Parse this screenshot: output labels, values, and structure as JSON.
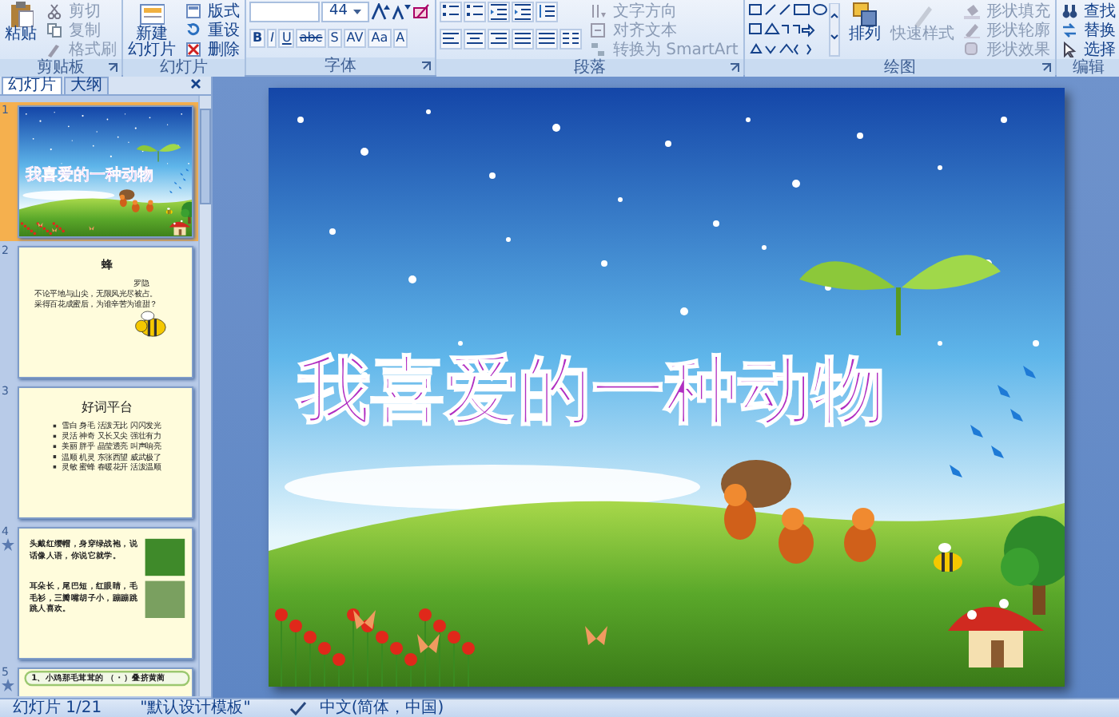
{
  "ribbon": {
    "groups": [
      {
        "kind": "clipboard",
        "label": "剪贴板",
        "launcher": true,
        "large": [
          {
            "lines": [
              "粘贴"
            ],
            "disabled": false
          }
        ],
        "small": [
          {
            "label": "剪切",
            "disabled": true
          },
          {
            "label": "复制",
            "disabled": true
          },
          {
            "label": "格式刷",
            "disabled": true
          }
        ]
      },
      {
        "kind": "slides",
        "label": "幻灯片",
        "launcher": false,
        "large": [
          {
            "lines": [
              "新建",
              "幻灯片"
            ],
            "disabled": false
          }
        ],
        "small": [
          {
            "label": "版式",
            "disabled": false
          },
          {
            "label": "重设",
            "disabled": false
          },
          {
            "label": "删除",
            "disabled": false
          }
        ]
      },
      {
        "kind": "font",
        "label": "字体",
        "launcher": true,
        "font_size": "44",
        "format_buttons": [
          "B",
          "I",
          "U",
          "abc",
          "S",
          "AV",
          "Aa",
          "A"
        ]
      },
      {
        "kind": "paragraph",
        "label": "段落",
        "launcher": true,
        "small": [
          {
            "label": "文字方向",
            "disabled": true
          },
          {
            "label": "对齐文本",
            "disabled": true
          },
          {
            "label": "转换为 SmartArt",
            "disabled": true
          }
        ]
      },
      {
        "kind": "drawing",
        "label": "绘图",
        "launcher": true,
        "large": [
          {
            "lines": [
              "排列"
            ],
            "disabled": false
          },
          {
            "lines": [
              "快速样式"
            ],
            "disabled": true
          }
        ],
        "small": [
          {
            "label": "形状填充",
            "disabled": true
          },
          {
            "label": "形状轮廓",
            "disabled": true
          },
          {
            "label": "形状效果",
            "disabled": true
          }
        ]
      },
      {
        "kind": "editing",
        "label": "编辑",
        "launcher": false,
        "small": [
          {
            "label": "查找",
            "disabled": false
          },
          {
            "label": "替换",
            "disabled": false
          },
          {
            "label": "选择",
            "disabled": false
          }
        ]
      }
    ]
  },
  "panel_tabs": [
    {
      "label": "幻灯片",
      "selected": true
    },
    {
      "label": "大纲",
      "selected": false
    }
  ],
  "thumbnails": [
    {
      "number": "1",
      "selected": true,
      "has_animation": false,
      "kind": "title",
      "title": "我喜爱的一种动物"
    },
    {
      "number": "2",
      "selected": false,
      "has_animation": false,
      "kind": "poem",
      "title": "蜂",
      "author": "罗隐",
      "lines": [
        "不论平地与山尖，无限风光尽被占。",
        "采得百花成蜜后，为谁辛苦为谁甜？"
      ]
    },
    {
      "number": "3",
      "selected": false,
      "has_animation": false,
      "kind": "words",
      "title": "好词平台",
      "rows": [
        "雪白 身毛 活泼无比 闪闪发光",
        "灵活 神奇 又长又尖 强壮有力",
        "美丽 胖乎 晶莹透亮 叫声响亮",
        "温顺 机灵 东张西望 威武极了",
        "灵敏 蜜蜂 春暖花开 活泼温顺"
      ]
    },
    {
      "number": "4",
      "selected": false,
      "has_animation": true,
      "kind": "riddles",
      "paragraphs": [
        "头戴红缨帽，身穿绿战袍，说话像人语，你说它就学。",
        "耳朵长，尾巴短，红眼睛，毛毛衫，三瓣嘴胡子小，蹦蹦跳跳人喜欢。"
      ]
    },
    {
      "number": "5",
      "selected": false,
      "has_animation": true,
      "kind": "quiz",
      "text": "1、小鸡那毛茸茸的 （ · ）叠挤黄蔺"
    }
  ],
  "slide": {
    "title": "我喜爱的一种动物"
  },
  "status_bar": {
    "slide_info": "幻灯片 1/21",
    "theme": "\"默认设计模板\"",
    "language": "中文(简体，中国)"
  }
}
